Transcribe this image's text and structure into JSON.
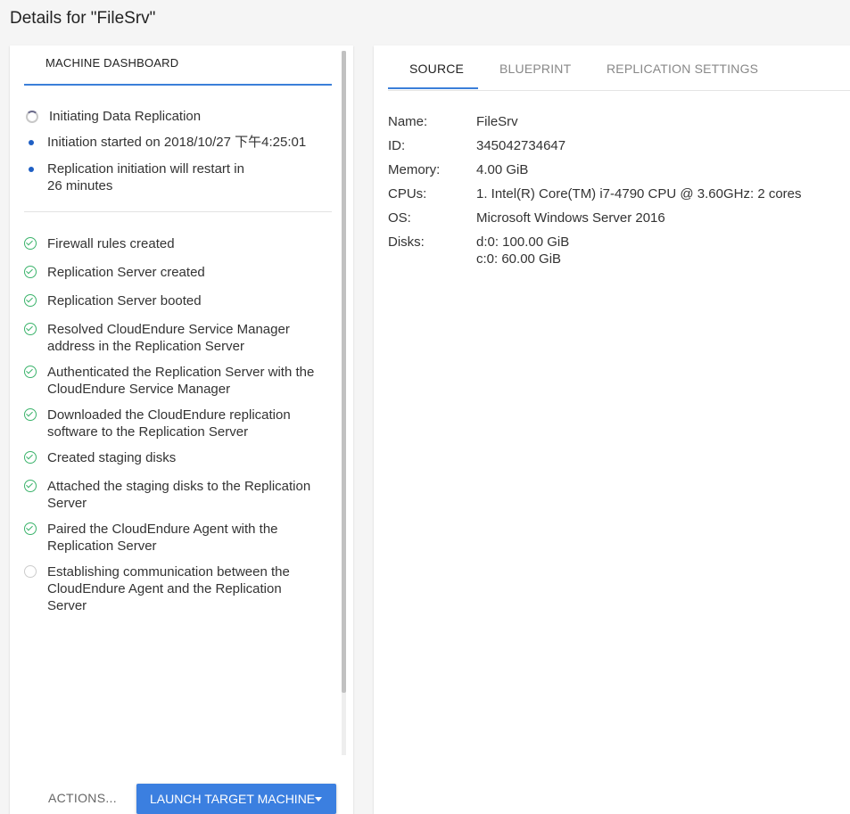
{
  "page": {
    "title": "Details for \"FileSrv\""
  },
  "left": {
    "tab_label": "MACHINE DASHBOARD",
    "current_status": [
      {
        "icon": "spinner",
        "text": "Initiating Data Replication"
      },
      {
        "icon": "dot",
        "text": "Initiation started on 2018/10/27 下午4:25:01"
      },
      {
        "icon": "dot",
        "text": "Replication initiation will restart in 26 minutes"
      }
    ],
    "steps": [
      {
        "status": "done",
        "text": "Firewall rules created"
      },
      {
        "status": "done",
        "text": "Replication Server created"
      },
      {
        "status": "done",
        "text": "Replication Server booted"
      },
      {
        "status": "done",
        "text": "Resolved CloudEndure Service Manager address in the Replication Server"
      },
      {
        "status": "done",
        "text": "Authenticated the Replication Server with the CloudEndure Service Manager"
      },
      {
        "status": "done",
        "text": "Downloaded the CloudEndure replication software to the Replication Server"
      },
      {
        "status": "done",
        "text": "Created staging disks"
      },
      {
        "status": "done",
        "text": "Attached the staging disks to the Replication Server"
      },
      {
        "status": "done",
        "text": "Paired the CloudEndure Agent with the Replication Server"
      },
      {
        "status": "pending",
        "text": "Establishing communication between the CloudEndure Agent and the Replication Server"
      }
    ],
    "actions_label": "ACTIONS...",
    "launch_label": "LAUNCH TARGET MACHINE"
  },
  "right": {
    "tabs": [
      "SOURCE",
      "BLUEPRINT",
      "REPLICATION SETTINGS"
    ],
    "active_tab": 0,
    "details": [
      {
        "key": "Name:",
        "value": "FileSrv"
      },
      {
        "key": "ID:",
        "value": "345042734647"
      },
      {
        "key": "Memory:",
        "value": "4.00 GiB"
      },
      {
        "key": "CPUs:",
        "value": "1. Intel(R) Core(TM) i7-4790 CPU @ 3.60GHz: 2 cores"
      },
      {
        "key": "OS:",
        "value": "Microsoft Windows Server 2016"
      },
      {
        "key": "Disks:",
        "value": "d:0: 100.00 GiB",
        "value2": "c:0: 60.00 GiB"
      }
    ]
  },
  "colors": {
    "accent": "#3b7fe0",
    "success": "#3bb36b",
    "dot": "#1f5fc4"
  }
}
